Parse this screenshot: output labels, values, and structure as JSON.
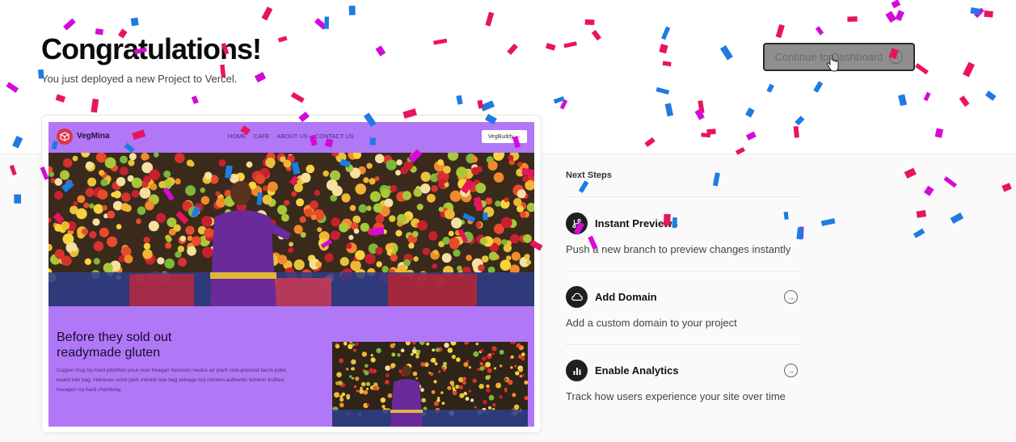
{
  "header": {
    "title": "Congratulations!",
    "subtitle": "You just deployed a new Project to Vercel.",
    "continue_label": "Continue to Dashboard"
  },
  "preview": {
    "brand": "VegMina",
    "nav_links": [
      "HOME",
      "CAFE",
      "ABOUT US",
      "CONTACT US"
    ],
    "cta_label": "VegBuddy →",
    "heading_line1": "Before they sold out",
    "heading_line2": "readymade gluten",
    "body_text": "Copper mug try-hard pitchfork pour-over freegan heirloom neutra air plant cold-pressed tacos poke beard tote bag. Heirloom echo park mlkshk tote bag selvage hot chicken authentic tumeric truffaut hexagon try-hard chambray."
  },
  "next_steps": {
    "label": "Next Steps",
    "items": [
      {
        "title": "Instant Previews",
        "description": "Push a new branch to preview changes instantly",
        "icon": "git-branch-icon",
        "has_arrow": false
      },
      {
        "title": "Add Domain",
        "description": "Add a custom domain to your project",
        "icon": "cloud-icon",
        "has_arrow": true
      },
      {
        "title": "Enable Analytics",
        "description": "Track how users experience your site over time",
        "icon": "bar-chart-icon",
        "has_arrow": true
      }
    ]
  },
  "colors": {
    "site_purple": "#b078f7",
    "confetti_magenta": "#d40bd6",
    "confetti_pink": "#e8145e",
    "confetti_blue": "#1e7be0"
  }
}
